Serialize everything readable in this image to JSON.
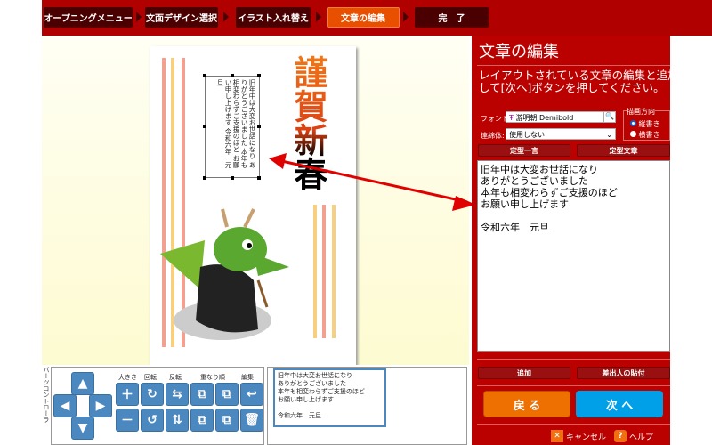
{
  "steps": [
    {
      "label": "オープニングメニュー",
      "active": false
    },
    {
      "label": "文面デザイン選択",
      "active": false
    },
    {
      "label": "イラスト入れ替え",
      "active": false
    },
    {
      "label": "文章の編集",
      "active": true
    },
    {
      "label": "完　了",
      "active": false
    }
  ],
  "card": {
    "greeting_lines": [
      "旧年中は大変お世話になり",
      "ありがとうございました",
      "本年も相変わらずご支援のほど",
      "お願い申し上げます",
      "",
      "令和六年　元旦"
    ],
    "greeting_text": "旧年中は大変お世話になり\nありがとうございました\n本年も相変わらずご支援のほど\nお願い申し上げます\n令和六年　元旦",
    "calligraphy": "謹賀新春"
  },
  "panel": {
    "title": "文章の編集",
    "description_line1": "レイアウトされている文章の編集と追加を",
    "description_line2": "して[次へ]ボタンを押してください。",
    "font_label": "フォント:",
    "font_value": "游明朝 Demibold",
    "renmen_label": "連綿体:",
    "renmen_value": "使用しない",
    "direction_group": "描画方向",
    "direction_options": [
      {
        "label": "縦書き",
        "selected": true
      },
      {
        "label": "横書き",
        "selected": false
      }
    ],
    "teikei_ichigon": "定型一言",
    "teikei_bunsho": "定型文章",
    "editor_text": "旧年中は大変お世話になり\nありがとうございました\n本年も相変わらずご支援のほど\nお願い申し上げます\n\n令和六年　元旦",
    "add": "追加",
    "sender_paste": "差出人の貼付",
    "back": "戻 る",
    "next": "次 へ",
    "cancel": "キャンセル",
    "help": "ヘルプ"
  },
  "controller": {
    "side_label": "パーツコントローラ",
    "labels": {
      "size": "大きさ",
      "rotate": "回転",
      "flip": "反転",
      "order": "重なり順",
      "edit": "編集"
    },
    "preview_text": "旧年中は大変お世話になり\nありがとうございました\n本年も相変わらずご支援のほど\nお願い申し上げます\n\n令和六年　元旦"
  },
  "colors": {
    "header": "#b00000",
    "active_step": "#e85000",
    "back": "#ee7000",
    "next": "#00a0e8",
    "icon_button": "#4b88c0"
  }
}
